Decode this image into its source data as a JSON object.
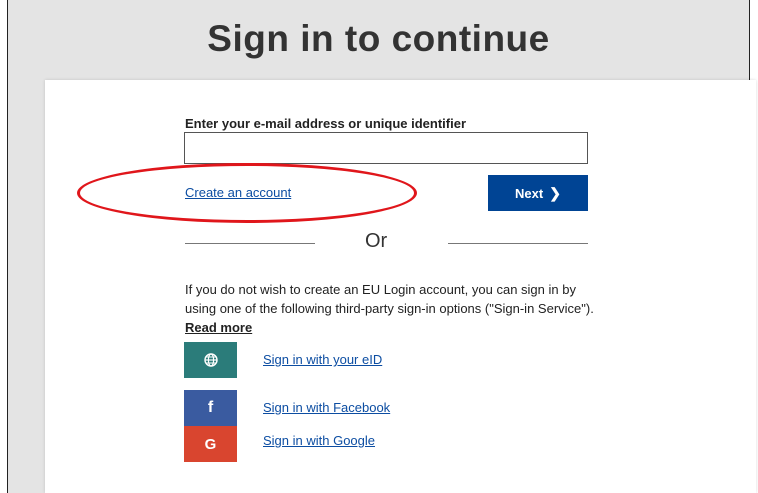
{
  "header": {
    "title": "Sign in to continue"
  },
  "form": {
    "email_label": "Enter your e-mail address or unique identifier",
    "email_value": "",
    "create_account_link": "Create an account",
    "next_button": "Next",
    "next_chevron": "❯"
  },
  "divider": {
    "or_text": "Or"
  },
  "third_party": {
    "info_text": "If you do not wish to create an EU Login account, you can sign in by using one of the following third-party sign-in options (\"Sign-in Service\").",
    "read_more": "Read more",
    "services": [
      {
        "icon": "globe-icon",
        "icon_glyph": "",
        "label": "Sign in with your eID",
        "color": "#2b7c7a"
      },
      {
        "icon": "facebook-icon",
        "icon_glyph": "f",
        "label": "Sign in with Facebook",
        "color": "#3a5ba0"
      },
      {
        "icon": "google-icon",
        "icon_glyph": "G",
        "label": "Sign in with Google",
        "color": "#d9452f"
      }
    ]
  },
  "colors": {
    "primary": "#004494",
    "link": "#0c4da2",
    "annotation": "#e0161b",
    "background": "#e4e4e4"
  }
}
